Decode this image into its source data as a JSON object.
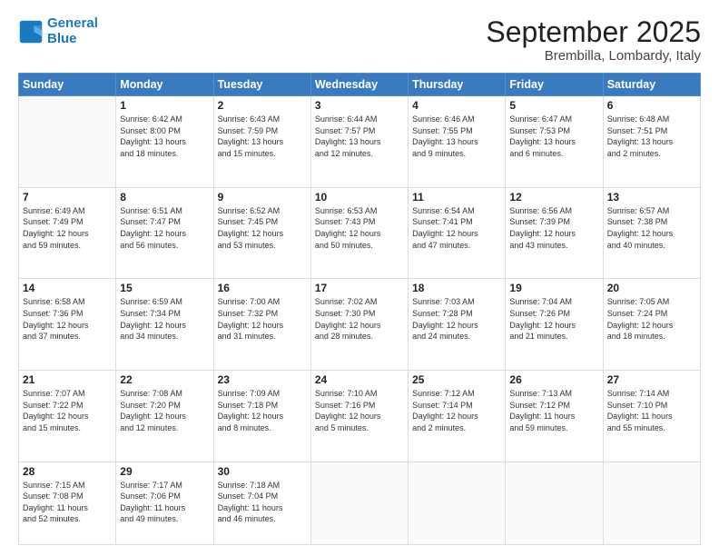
{
  "logo": {
    "line1": "General",
    "line2": "Blue"
  },
  "title": "September 2025",
  "location": "Brembilla, Lombardy, Italy",
  "weekdays": [
    "Sunday",
    "Monday",
    "Tuesday",
    "Wednesday",
    "Thursday",
    "Friday",
    "Saturday"
  ],
  "weeks": [
    [
      {
        "day": "",
        "info": ""
      },
      {
        "day": "1",
        "info": "Sunrise: 6:42 AM\nSunset: 8:00 PM\nDaylight: 13 hours\nand 18 minutes."
      },
      {
        "day": "2",
        "info": "Sunrise: 6:43 AM\nSunset: 7:59 PM\nDaylight: 13 hours\nand 15 minutes."
      },
      {
        "day": "3",
        "info": "Sunrise: 6:44 AM\nSunset: 7:57 PM\nDaylight: 13 hours\nand 12 minutes."
      },
      {
        "day": "4",
        "info": "Sunrise: 6:46 AM\nSunset: 7:55 PM\nDaylight: 13 hours\nand 9 minutes."
      },
      {
        "day": "5",
        "info": "Sunrise: 6:47 AM\nSunset: 7:53 PM\nDaylight: 13 hours\nand 6 minutes."
      },
      {
        "day": "6",
        "info": "Sunrise: 6:48 AM\nSunset: 7:51 PM\nDaylight: 13 hours\nand 2 minutes."
      }
    ],
    [
      {
        "day": "7",
        "info": "Sunrise: 6:49 AM\nSunset: 7:49 PM\nDaylight: 12 hours\nand 59 minutes."
      },
      {
        "day": "8",
        "info": "Sunrise: 6:51 AM\nSunset: 7:47 PM\nDaylight: 12 hours\nand 56 minutes."
      },
      {
        "day": "9",
        "info": "Sunrise: 6:52 AM\nSunset: 7:45 PM\nDaylight: 12 hours\nand 53 minutes."
      },
      {
        "day": "10",
        "info": "Sunrise: 6:53 AM\nSunset: 7:43 PM\nDaylight: 12 hours\nand 50 minutes."
      },
      {
        "day": "11",
        "info": "Sunrise: 6:54 AM\nSunset: 7:41 PM\nDaylight: 12 hours\nand 47 minutes."
      },
      {
        "day": "12",
        "info": "Sunrise: 6:56 AM\nSunset: 7:39 PM\nDaylight: 12 hours\nand 43 minutes."
      },
      {
        "day": "13",
        "info": "Sunrise: 6:57 AM\nSunset: 7:38 PM\nDaylight: 12 hours\nand 40 minutes."
      }
    ],
    [
      {
        "day": "14",
        "info": "Sunrise: 6:58 AM\nSunset: 7:36 PM\nDaylight: 12 hours\nand 37 minutes."
      },
      {
        "day": "15",
        "info": "Sunrise: 6:59 AM\nSunset: 7:34 PM\nDaylight: 12 hours\nand 34 minutes."
      },
      {
        "day": "16",
        "info": "Sunrise: 7:00 AM\nSunset: 7:32 PM\nDaylight: 12 hours\nand 31 minutes."
      },
      {
        "day": "17",
        "info": "Sunrise: 7:02 AM\nSunset: 7:30 PM\nDaylight: 12 hours\nand 28 minutes."
      },
      {
        "day": "18",
        "info": "Sunrise: 7:03 AM\nSunset: 7:28 PM\nDaylight: 12 hours\nand 24 minutes."
      },
      {
        "day": "19",
        "info": "Sunrise: 7:04 AM\nSunset: 7:26 PM\nDaylight: 12 hours\nand 21 minutes."
      },
      {
        "day": "20",
        "info": "Sunrise: 7:05 AM\nSunset: 7:24 PM\nDaylight: 12 hours\nand 18 minutes."
      }
    ],
    [
      {
        "day": "21",
        "info": "Sunrise: 7:07 AM\nSunset: 7:22 PM\nDaylight: 12 hours\nand 15 minutes."
      },
      {
        "day": "22",
        "info": "Sunrise: 7:08 AM\nSunset: 7:20 PM\nDaylight: 12 hours\nand 12 minutes."
      },
      {
        "day": "23",
        "info": "Sunrise: 7:09 AM\nSunset: 7:18 PM\nDaylight: 12 hours\nand 8 minutes."
      },
      {
        "day": "24",
        "info": "Sunrise: 7:10 AM\nSunset: 7:16 PM\nDaylight: 12 hours\nand 5 minutes."
      },
      {
        "day": "25",
        "info": "Sunrise: 7:12 AM\nSunset: 7:14 PM\nDaylight: 12 hours\nand 2 minutes."
      },
      {
        "day": "26",
        "info": "Sunrise: 7:13 AM\nSunset: 7:12 PM\nDaylight: 11 hours\nand 59 minutes."
      },
      {
        "day": "27",
        "info": "Sunrise: 7:14 AM\nSunset: 7:10 PM\nDaylight: 11 hours\nand 55 minutes."
      }
    ],
    [
      {
        "day": "28",
        "info": "Sunrise: 7:15 AM\nSunset: 7:08 PM\nDaylight: 11 hours\nand 52 minutes."
      },
      {
        "day": "29",
        "info": "Sunrise: 7:17 AM\nSunset: 7:06 PM\nDaylight: 11 hours\nand 49 minutes."
      },
      {
        "day": "30",
        "info": "Sunrise: 7:18 AM\nSunset: 7:04 PM\nDaylight: 11 hours\nand 46 minutes."
      },
      {
        "day": "",
        "info": ""
      },
      {
        "day": "",
        "info": ""
      },
      {
        "day": "",
        "info": ""
      },
      {
        "day": "",
        "info": ""
      }
    ]
  ]
}
